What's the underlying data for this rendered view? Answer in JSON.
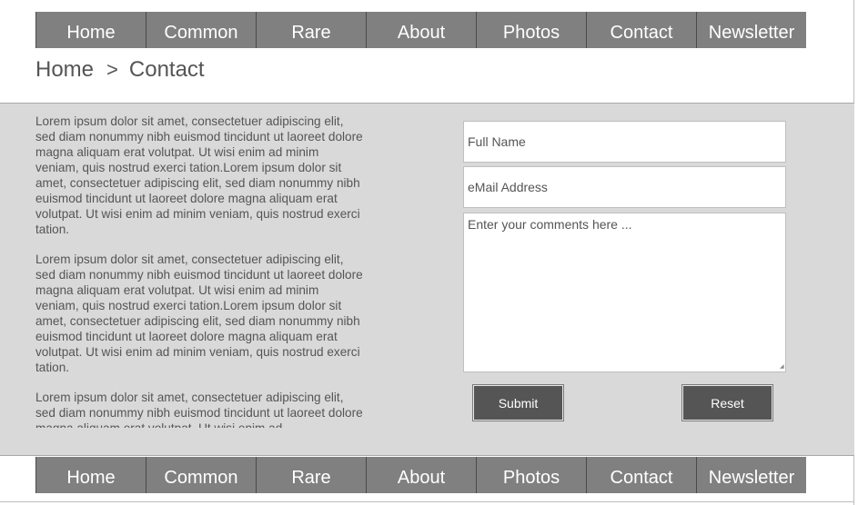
{
  "nav": {
    "items": [
      {
        "label": "Home"
      },
      {
        "label": "Common"
      },
      {
        "label": "Rare"
      },
      {
        "label": "About"
      },
      {
        "label": "Photos"
      },
      {
        "label": "Contact"
      },
      {
        "label": "Newsletter"
      }
    ]
  },
  "breadcrumb": {
    "home": "Home",
    "separator": ">",
    "current": "Contact"
  },
  "content": {
    "paragraphs": [
      "Lorem ipsum dolor sit amet, consectetuer adipiscing elit, sed diam nonummy nibh euismod tincidunt ut laoreet dolore magna aliquam erat volutpat. Ut wisi enim ad minim veniam, quis nostrud exerci tation.Lorem ipsum dolor sit amet, consectetuer adipiscing elit, sed diam nonummy nibh euismod tincidunt ut laoreet dolore magna aliquam erat volutpat. Ut wisi enim ad minim veniam, quis nostrud exerci tation.",
      "Lorem ipsum dolor sit amet, consectetuer adipiscing elit, sed diam nonummy nibh euismod tincidunt ut laoreet dolore magna aliquam erat volutpat. Ut wisi enim ad minim veniam, quis nostrud exerci tation.Lorem ipsum dolor sit amet, consectetuer adipiscing elit, sed diam nonummy nibh euismod tincidunt ut laoreet dolore magna aliquam erat volutpat. Ut wisi enim ad minim veniam, quis nostrud exerci tation.",
      "Lorem ipsum dolor sit amet, consectetuer adipiscing elit, sed diam nonummy nibh euismod tincidunt ut laoreet dolore magna aliquam erat volutpat. Ut wisi enim ad"
    ]
  },
  "form": {
    "name_placeholder": "Full Name",
    "email_placeholder": "eMail Address",
    "comments_placeholder": "Enter your comments here ...",
    "submit_label": "Submit",
    "reset_label": "Reset"
  },
  "colors": {
    "nav_background": "#808080",
    "content_background": "#d9d9d9",
    "button_background": "#555555",
    "text": "#555555"
  },
  "icons": {
    "textarea_resize": "resize-grip-icon"
  }
}
